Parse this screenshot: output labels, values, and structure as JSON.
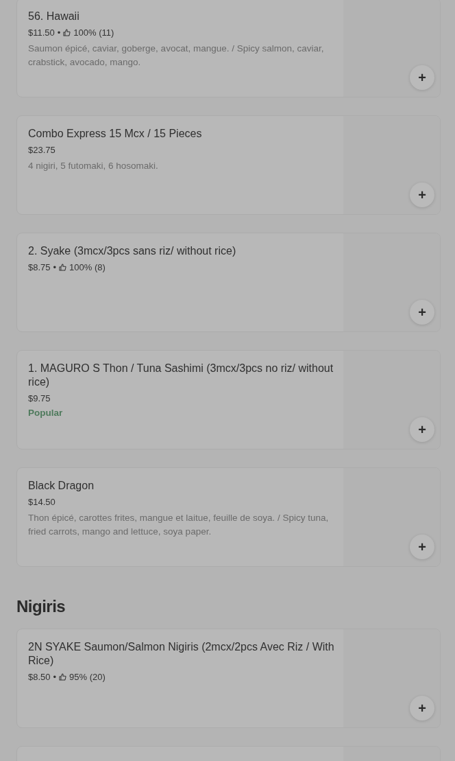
{
  "sections": [
    {
      "items": [
        {
          "kind": "item",
          "name": "56. Hawaii",
          "price": "$11.50",
          "separator": "•",
          "rating": "100% (11)",
          "description": "Saumon épicé, caviar, goberge, avocat, mangue. / Spicy salmon, caviar, crabstick, avocado, mango.",
          "add": "+"
        },
        {
          "kind": "item",
          "name": "Combo Express 15 Mcx / 15 Pieces",
          "price": "$23.75",
          "description": "4 nigiri, 5 futomaki, 6 hosomaki.",
          "add": "+"
        },
        {
          "kind": "item",
          "name": "2. Syake (3mcx/3pcs sans riz/ without rice)",
          "price": "$8.75",
          "separator": "•",
          "rating": "100% (8)",
          "add": "+"
        },
        {
          "kind": "item",
          "name": "1. MAGURO S Thon / Tuna Sashimi (3mcx/3pcs no riz/ without rice)",
          "price": "$9.75",
          "badge": "Popular",
          "add": "+"
        },
        {
          "kind": "item",
          "name": "Black Dragon",
          "price": "$14.50",
          "description": "Thon épicé, carottes frites, mangue et laitue, feuille de soya. / Spicy tuna, fried carrots, mango and lettuce, soya paper.",
          "add": "+"
        }
      ]
    },
    {
      "title": "Nigiris",
      "items": [
        {
          "kind": "item",
          "name": "2N SYAKE Saumon/Salmon Nigiris (2mcx/2pcs Avec Riz / With Rice)",
          "price": "$8.50",
          "separator": "•",
          "rating": "95% (20)",
          "add": "+"
        },
        {
          "kind": "cut_off"
        }
      ]
    }
  ]
}
